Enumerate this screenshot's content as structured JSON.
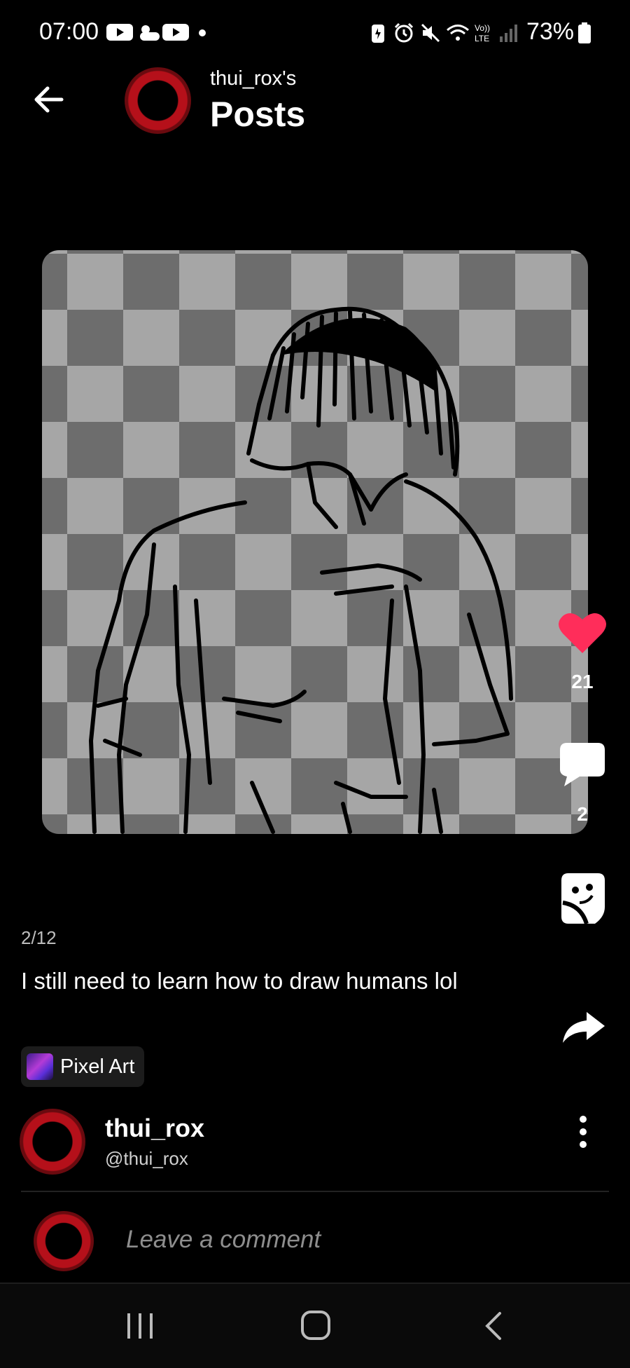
{
  "status_bar": {
    "time": "07:00",
    "battery": "73%",
    "icons": [
      "youtube-icon",
      "weather-icon",
      "youtube-icon",
      "dot-icon",
      "battery-saver-icon",
      "alarm-icon",
      "mute-icon",
      "wifi-icon",
      "volte-icon",
      "signal-icon",
      "battery-icon"
    ]
  },
  "header": {
    "username": "thui_rox's",
    "title": "Posts"
  },
  "post": {
    "image_description_icon": "pixel-art-drawing",
    "counter": "2/12",
    "caption": "I still need to learn how to draw humans lol",
    "tag": "Pixel Art"
  },
  "actions": {
    "likes": "21",
    "comments": "2",
    "like_color": "#ff2d5a"
  },
  "author": {
    "name": "thui_rox",
    "handle": "@thui_rox"
  },
  "comment": {
    "placeholder": "Leave a comment"
  }
}
